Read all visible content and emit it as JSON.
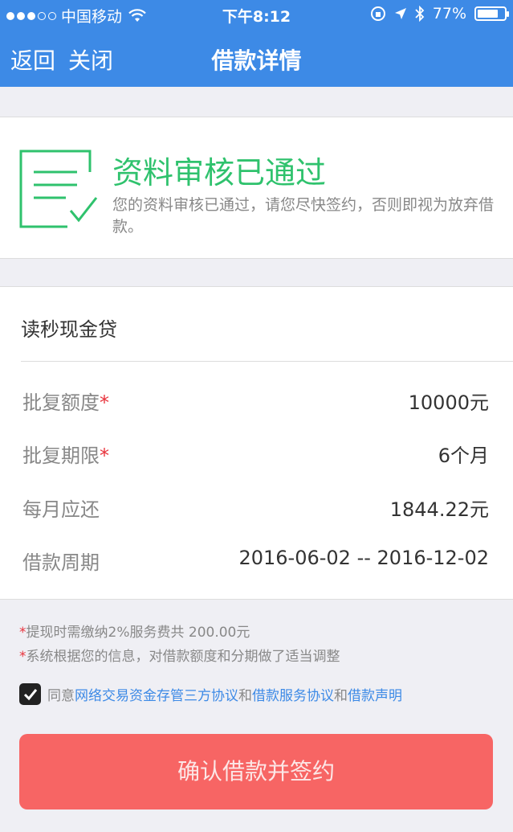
{
  "status_bar": {
    "carrier": "中国移动",
    "time": "下午8:12",
    "battery": "77%",
    "battery_level": 0.77
  },
  "nav": {
    "back_label": "返回",
    "close_label": "关闭",
    "title": "借款详情"
  },
  "review_status": {
    "title": "资料审核已通过",
    "description": "您的资料审核已通过，请您尽快签约，否则即视为放弃借款。",
    "accent_color": "#2fc26d"
  },
  "loan": {
    "product_name": "读秒现金贷",
    "rows": [
      {
        "label": "批复额度",
        "required": "*",
        "value": "10000元"
      },
      {
        "label": "批复期限",
        "required": "*",
        "value": "6个月"
      },
      {
        "label": "每月应还",
        "required": "",
        "value": "1844.22元"
      },
      {
        "label": "借款周期",
        "required": "",
        "value": "2016-06-02 -- 2016-12-02"
      }
    ]
  },
  "notes": [
    {
      "star": "*",
      "text": "提现时需缴纳2%服务费共 200.00元"
    },
    {
      "star": "*",
      "text": "系统根据您的信息，对借款额度和分期做了适当调整"
    }
  ],
  "agreement": {
    "prefix": "同意",
    "link1": "网络交易资金存管三方协议",
    "and1": "和",
    "link2": "借款服务协议",
    "and2": "和",
    "link3": "借款声明",
    "checked": true
  },
  "confirm_button": {
    "label": "确认借款并签约",
    "color": "#f76564"
  },
  "colors": {
    "nav_blue": "#3d8ae6",
    "required_red": "#e8333c"
  }
}
